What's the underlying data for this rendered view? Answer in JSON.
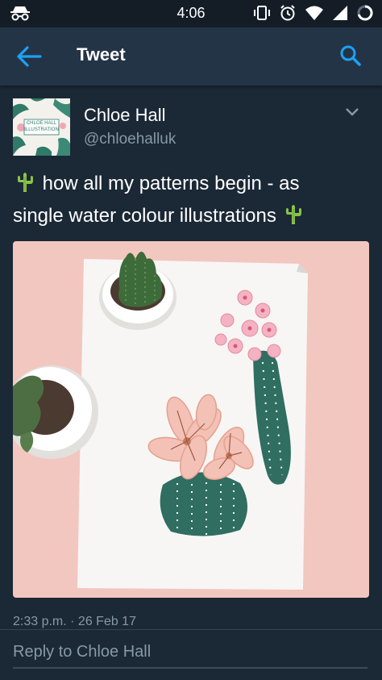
{
  "status_bar": {
    "time": "4:06",
    "icons": [
      "incognito-icon",
      "vibrate-icon",
      "alarm-icon",
      "wifi-icon",
      "signal-icon",
      "battery-icon"
    ]
  },
  "header": {
    "title": "Tweet",
    "back_icon": "arrow-left-icon",
    "search_icon": "search-icon",
    "accent_color": "#1da1f2"
  },
  "tweet": {
    "display_name": "Chloe Hall",
    "handle": "@chloehalluk",
    "avatar_text_line1": "CHLOE HALL",
    "avatar_text_line2": "ILLUSTRATION",
    "text_line1": " how all my patterns begin - as",
    "text_line2": "single water colour illustrations ",
    "emoji": "cactus-icon",
    "timestamp": "2:33 p.m. · 26 Feb 17"
  },
  "reply": {
    "placeholder": "Reply to Chloe Hall"
  },
  "colors": {
    "background": "#1b2836",
    "app_bar": "#243447",
    "secondary_text": "#8899a6"
  }
}
